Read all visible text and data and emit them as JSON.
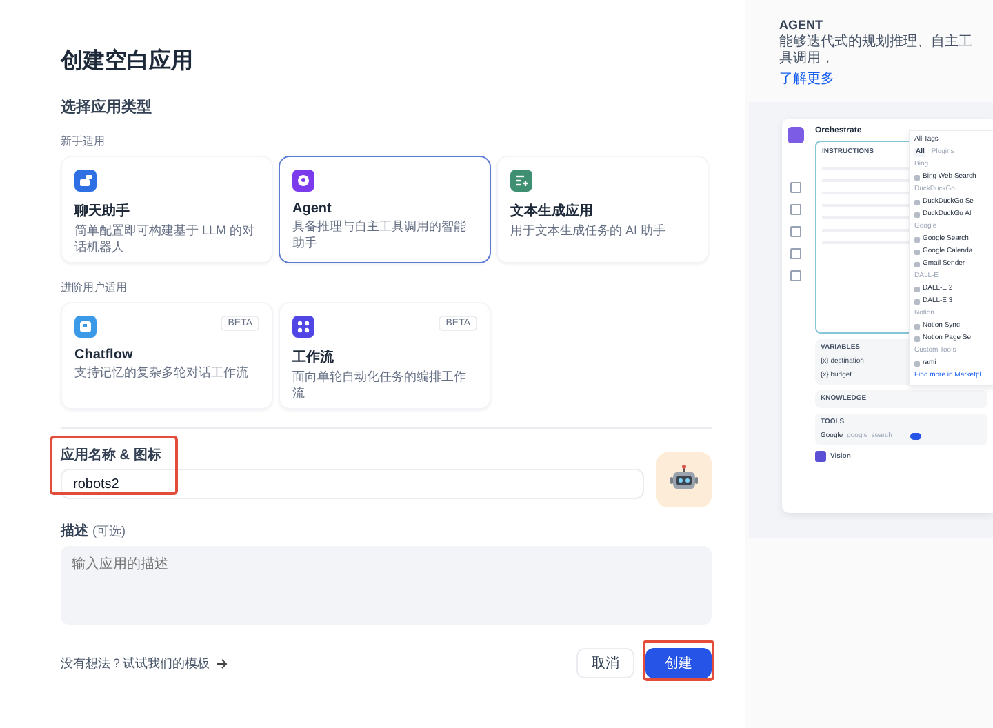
{
  "title": "创建空白应用",
  "type_section": {
    "label": "选择应用类型",
    "groups": [
      {
        "label": "新手适用",
        "cards": [
          {
            "kind": "chat",
            "color": "#2f6fe4",
            "name": "聊天助手",
            "description": "简单配置即可构建基于 LLM 的对话机器人",
            "selected": false
          },
          {
            "kind": "agent",
            "color": "#7c3aed",
            "name": "Agent",
            "description": "具备推理与自主工具调用的智能助手",
            "selected": true
          },
          {
            "kind": "completion",
            "color": "#3f8f72",
            "name": "文本生成应用",
            "description": "用于文本生成任务的 AI 助手",
            "selected": false
          }
        ]
      },
      {
        "label": "进阶用户适用",
        "cards": [
          {
            "kind": "chatflow",
            "color": "#3b9ae8",
            "name": "Chatflow",
            "description": "支持记忆的复杂多轮对话工作流",
            "selected": false,
            "badge": "BETA"
          },
          {
            "kind": "workflow",
            "color": "#4f46e5",
            "name": "工作流",
            "description": "面向单轮自动化任务的编排工作流",
            "selected": false,
            "badge": "BETA"
          }
        ]
      }
    ]
  },
  "name_field": {
    "label": "应用名称 & 图标",
    "value": "robots2",
    "highlighted": true
  },
  "description_field": {
    "label": "描述",
    "hint": "(可选)",
    "placeholder": "输入应用的描述"
  },
  "template_link": "没有想法？试试我们的模板",
  "buttons": [
    {
      "kind": "secondary",
      "label": "取消",
      "highlighted": false
    },
    {
      "kind": "primary",
      "label": "创建",
      "highlighted": true
    }
  ],
  "side": {
    "heading": "AGENT",
    "description": "能够迭代式的规划推理、自主工具调用，",
    "link": "了解更多",
    "preview": {
      "title": "Orchestrate",
      "instructions_label": "INSTRUCTIONS",
      "variables_label": "VARIABLES",
      "variables": [
        "{x} destination",
        "{x} budget"
      ],
      "knowledge_label": "KNOWLEDGE",
      "tools_label": "TOOLS",
      "tool": {
        "name": "Google",
        "id": "google_search",
        "on": true
      },
      "bot": "Vision",
      "dropdown": {
        "filter": "All Tags",
        "tabs": [
          {
            "label": "All",
            "selected": true
          },
          {
            "label": "Plugins",
            "selected": false
          }
        ],
        "groups": [
          {
            "name": "Bing",
            "items": [
              "Bing Web Search"
            ]
          },
          {
            "name": "DuckDuckGo",
            "items": [
              "DuckDuckGo Se",
              "DuckDuckGo AI"
            ]
          },
          {
            "name": "Google",
            "items": [
              "Google Search",
              "Google Calenda",
              "Gmail Sender"
            ]
          },
          {
            "name": "DALL-E",
            "items": [
              "DALL-E 2",
              "DALL-E 3"
            ]
          },
          {
            "name": "Notion",
            "items": [
              "Notion Sync",
              "Notion Page Se"
            ]
          },
          {
            "name": "Custom Tools",
            "items": [
              "rami"
            ]
          }
        ],
        "footer": "Find more in Marketpl"
      }
    }
  }
}
